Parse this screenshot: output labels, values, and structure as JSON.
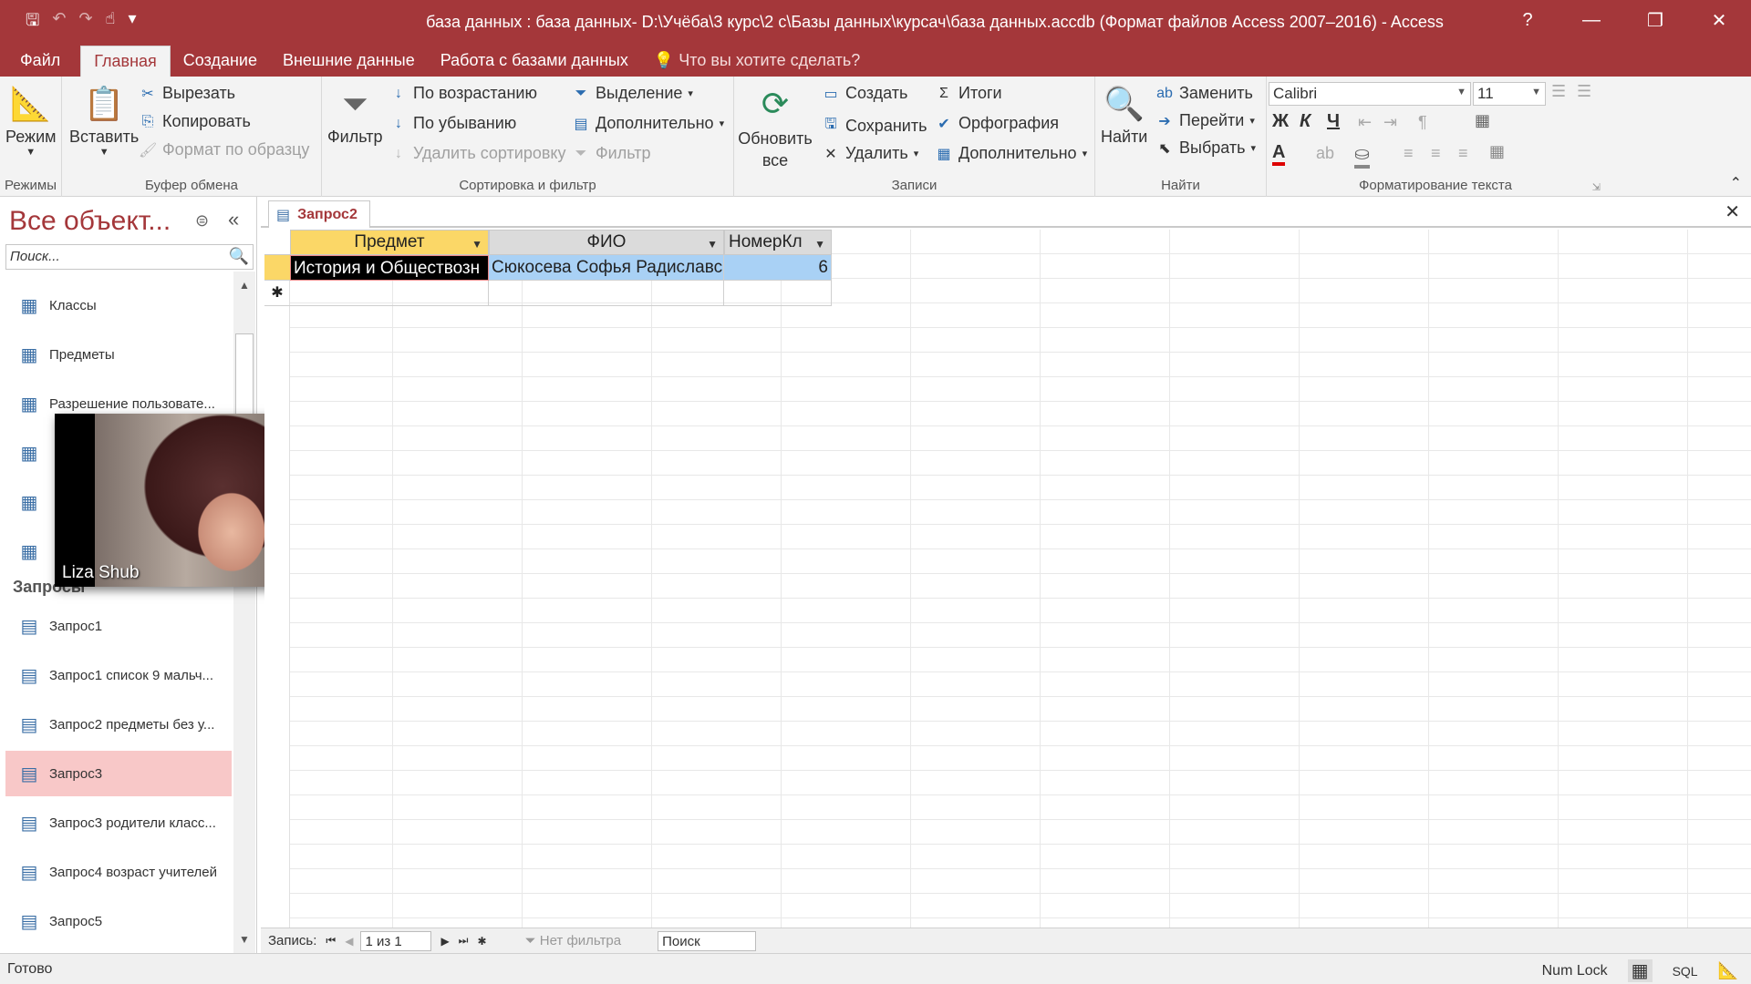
{
  "title": "база данных : база данных- D:\\Учёба\\3 курс\\2 с\\Базы данных\\курсач\\база данных.accdb (Формат файлов Access 2007–2016) - Access",
  "window_controls": {
    "help": "?",
    "minimize": "—",
    "restore": "❐",
    "close": "✕"
  },
  "quick_access": {
    "save": "🖫",
    "undo": "↶",
    "redo": "↷",
    "touch": "☝",
    "customize": "▾"
  },
  "tabs": [
    "Файл",
    "Главная",
    "Создание",
    "Внешние данные",
    "Работа с базами данных"
  ],
  "active_tab": "Главная",
  "tell_me": "Что вы хотите сделать?",
  "ribbon": {
    "modes": {
      "label": "Режимы",
      "btn": "Режим"
    },
    "clipboard": {
      "label": "Буфер обмена",
      "paste": "Вставить",
      "cut": "Вырезать",
      "copy": "Копировать",
      "format_painter": "Формат по образцу"
    },
    "sort_filter": {
      "label": "Сортировка и фильтр",
      "filter": "Фильтр",
      "asc": "По возрастанию",
      "desc": "По убыванию",
      "remove_sort": "Удалить сортировку",
      "selection": "Выделение",
      "advanced": "Дополнительно",
      "toggle_filter": "Фильтр"
    },
    "records": {
      "label": "Записи",
      "refresh": "Обновить все",
      "new": "Создать",
      "save": "Сохранить",
      "delete": "Удалить",
      "totals": "Итоги",
      "spelling": "Орфография",
      "more": "Дополнительно"
    },
    "find": {
      "label": "Найти",
      "find": "Найти",
      "replace": "Заменить",
      "goto": "Перейти",
      "select": "Выбрать"
    },
    "text_format": {
      "label": "Форматирование текста",
      "font": "Calibri",
      "size": "11",
      "bold": "Ж",
      "italic": "К",
      "underline": "Ч",
      "font_color": "A"
    }
  },
  "nav": {
    "title": "Все объект...",
    "search_placeholder": "Поиск...",
    "tables": [
      "Классы",
      "Предметы",
      "Разрешение пользовате...",
      "",
      "",
      ""
    ],
    "group_queries": "Запросы",
    "queries": [
      "Запрос1",
      "Запрос1 список 9 мальч...",
      "Запрос2 предметы без у...",
      "Запрос3",
      "Запрос3 родители класс...",
      "Запрос4 возраст учителей",
      "Запрос5"
    ],
    "selected": "Запрос3"
  },
  "document_tab": "Запрос2",
  "datasheet": {
    "columns": [
      "Предмет",
      "ФИО",
      "НомерКл"
    ],
    "rows": [
      [
        "История и Обществозн",
        "Сюкосева Софья Радиславс",
        "6"
      ]
    ],
    "new_row_marker": "✱"
  },
  "record_nav": {
    "label": "Запись:",
    "current": "1 из 1",
    "filter": "Нет фильтра",
    "search": "Поиск"
  },
  "status": {
    "left": "Готово",
    "numlock": "Num Lock",
    "sql": "SQL"
  },
  "video_overlay": {
    "name": "Liza Shub"
  }
}
